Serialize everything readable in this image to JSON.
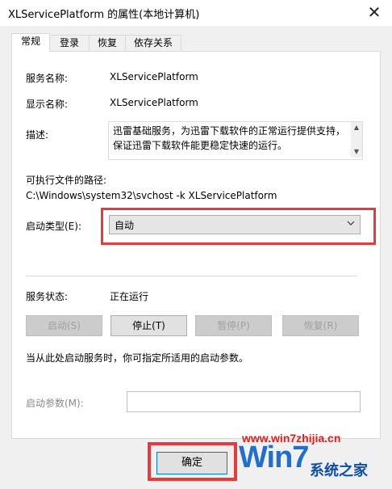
{
  "window": {
    "title": "XLServicePlatform 的属性(本地计算机)",
    "close_glyph": "✕"
  },
  "tabs": [
    {
      "label": "常规",
      "active": true
    },
    {
      "label": "登录",
      "active": false
    },
    {
      "label": "恢复",
      "active": false
    },
    {
      "label": "依存关系",
      "active": false
    }
  ],
  "general": {
    "service_name_label": "服务名称:",
    "service_name": "XLServicePlatform",
    "display_name_label": "显示名称:",
    "display_name": "XLServicePlatform",
    "description_label": "描述:",
    "description": "迅雷基础服务，为迅雷下载软件的正常运行提供支持，保证迅雷下载软件能更稳定快速的运行。",
    "exe_path_label": "可执行文件的路径:",
    "exe_path": "C:\\Windows\\system32\\svchost -k XLServicePlatform",
    "startup_type_label": "启动类型(E):",
    "startup_type_value": "自动",
    "status_label": "服务状态:",
    "status_value": "正在运行",
    "buttons": {
      "start": "启动(S)",
      "stop": "停止(T)",
      "pause": "暂停(P)",
      "resume": "恢复(R)"
    },
    "hint": "当从此处启动服务时，你可指定所适用的启动参数。",
    "start_params_label": "启动参数(M):",
    "start_params_value": ""
  },
  "footer": {
    "ok_label": "确定"
  },
  "watermark": {
    "url": "www.win7zhijia.cn",
    "logo": "Win7",
    "site": "系统之家"
  },
  "colors": {
    "highlight": "#e83a3a",
    "accent": "#0078d7"
  }
}
